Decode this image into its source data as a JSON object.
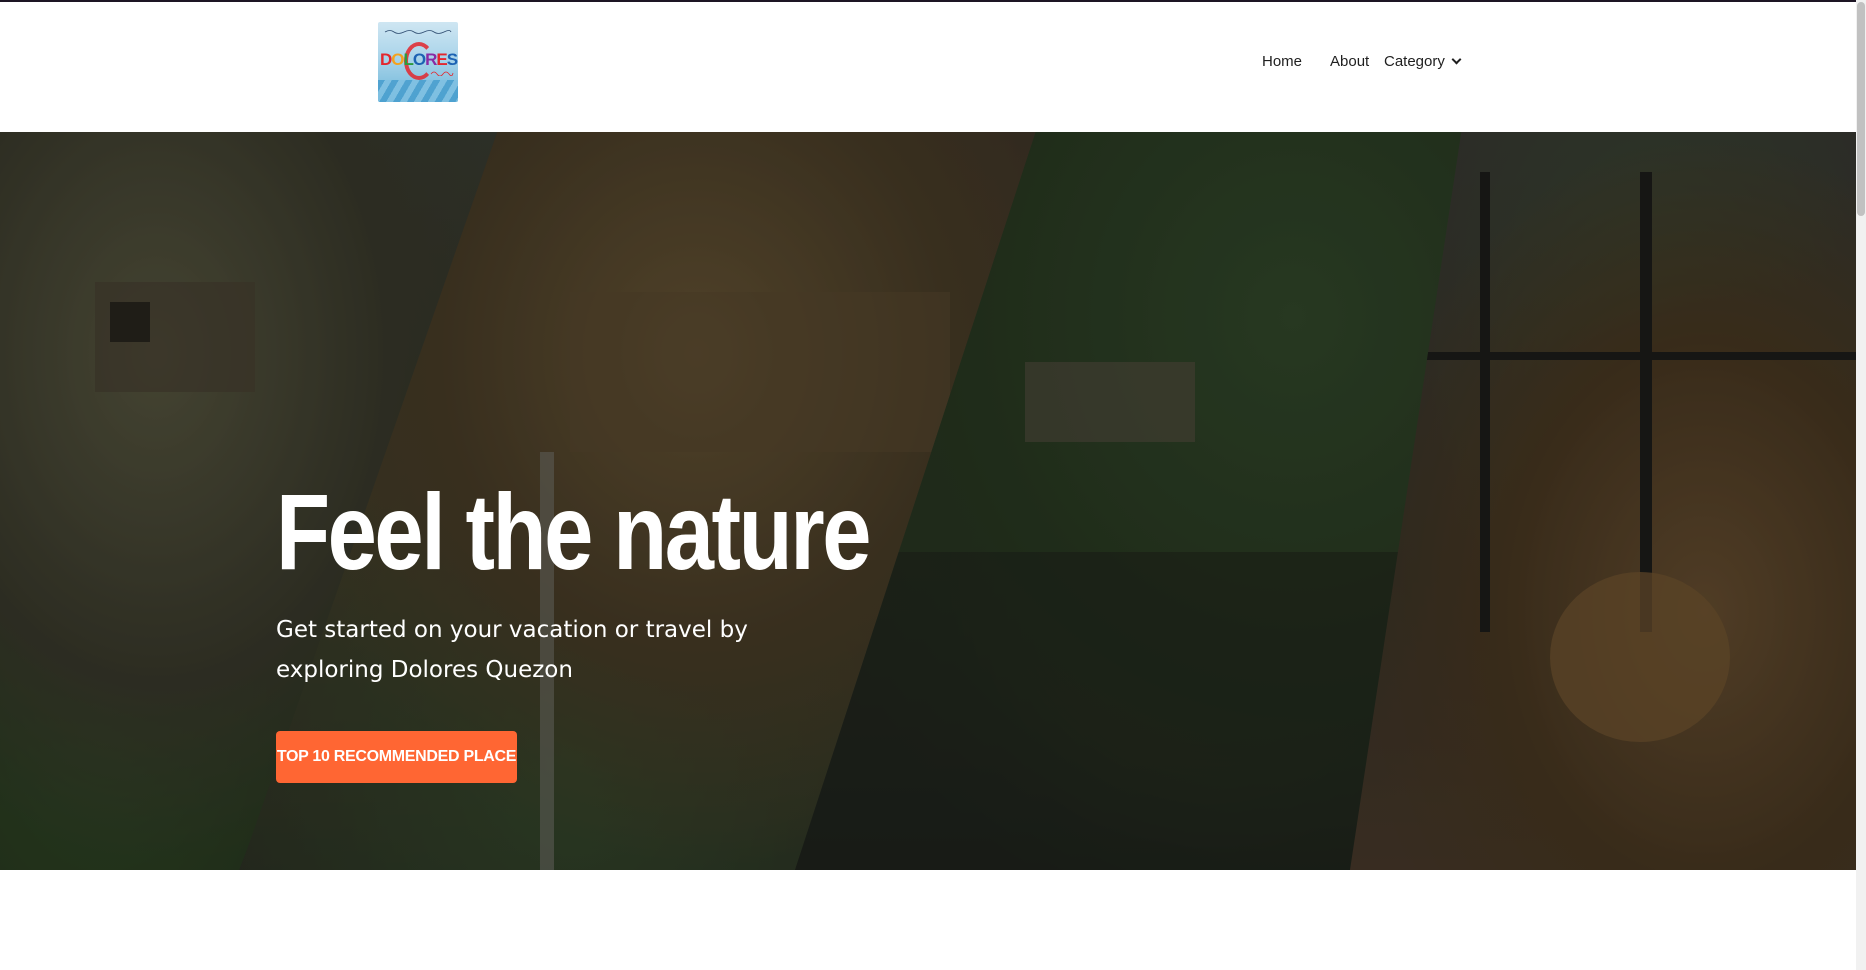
{
  "header": {
    "logo": {
      "icon": "dolores-quezon-logo",
      "letters": [
        "D",
        "O",
        "L",
        "O",
        "R",
        "E",
        "S"
      ]
    },
    "nav": [
      {
        "label": "Home"
      },
      {
        "label": "About"
      },
      {
        "label": "Category",
        "icon": "chevron-down-icon"
      }
    ]
  },
  "hero": {
    "title": "Feel the nature",
    "subtitle": "Get started on your vacation or travel by exploring Dolores Quezon",
    "cta_label": "TOP 10 RECOMMENDED PLACE",
    "colors": {
      "cta_background": "#ff6633",
      "text": "#ffffff"
    }
  }
}
